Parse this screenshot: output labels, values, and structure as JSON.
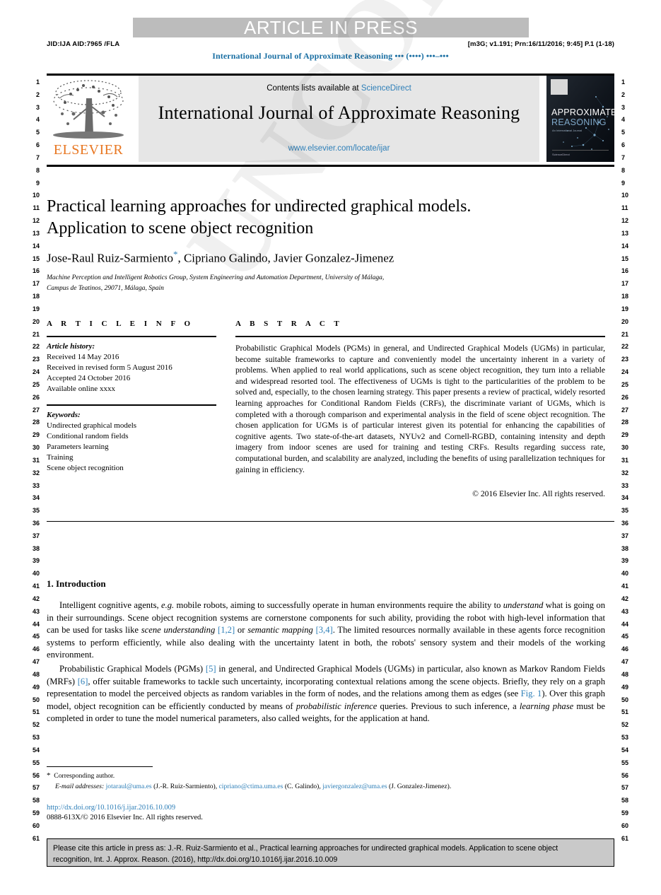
{
  "banner": {
    "article_in_press": "ARTICLE IN PRESS",
    "jid": "JID:IJA    AID:7965 /FLA",
    "build_stamp": "[m3G; v1.191; Prn:16/11/2016; 9:45] P.1 (1-18)",
    "running_head": "International Journal of Approximate Reasoning ••• (••••) •••–•••"
  },
  "masthead": {
    "contents_prefix": "Contents lists available at ",
    "sciencedirect": "ScienceDirect",
    "journal_title": "International Journal of Approximate Reasoning",
    "journal_url": "www.elsevier.com/locate/ijar",
    "publisher": "ELSEVIER",
    "cover_line1": "APPROXIMATE",
    "cover_line2": "REASONING",
    "cover_sub": "An International Journal",
    "cover_foot": "Available online at www.sciencedirect.com",
    "cover_foot2": "ScienceDirect"
  },
  "article": {
    "title_line1": "Practical learning approaches for undirected graphical models.",
    "title_line2": "Application to scene object recognition",
    "authors_part1": "Jose-Raul Ruiz-Sarmiento",
    "corresponding_marker": "*",
    "authors_part2": ", Cipriano Galindo, Javier Gonzalez-Jimenez",
    "affiliation_line1": "Machine Perception and Intelligent Robotics Group, System Engineering and Automation Department, University of Málaga,",
    "affiliation_line2": "Campus de Teatinos, 29071, Málaga, Spain"
  },
  "info": {
    "heading": "A R T I C L E   I N F O",
    "history_label": "Article history:",
    "history": [
      "Received 14 May 2016",
      "Received in revised form 5 August 2016",
      "Accepted 24 October 2016",
      "Available online xxxx"
    ],
    "keywords_label": "Keywords:",
    "keywords": [
      "Undirected graphical models",
      "Conditional random fields",
      "Parameters learning",
      "Training",
      "Scene object recognition"
    ]
  },
  "abstract": {
    "heading": "A B S T R A C T",
    "text": "Probabilistic Graphical Models (PGMs) in general, and Undirected Graphical Models (UGMs) in particular, become suitable frameworks to capture and conveniently model the uncertainty inherent in a variety of problems. When applied to real world applications, such as scene object recognition, they turn into a reliable and widespread resorted tool. The effectiveness of UGMs is tight to the particularities of the problem to be solved and, especially, to the chosen learning strategy. This paper presents a review of practical, widely resorted learning approaches for Conditional Random Fields (CRFs), the discriminate variant of UGMs, which is completed with a thorough comparison and experimental analysis in the field of scene object recognition. The chosen application for UGMs is of particular interest given its potential for enhancing the capabilities of cognitive agents. Two state-of-the-art datasets, NYUv2 and Cornell-RGBD, containing intensity and depth imagery from indoor scenes are used for training and testing CRFs. Results regarding success rate, computational burden, and scalability are analyzed, including the benefits of using parallelization techniques for gaining in efficiency.",
    "copyright": "© 2016 Elsevier Inc. All rights reserved."
  },
  "body": {
    "section_heading": "1. Introduction",
    "paragraph1": {
      "seg1": "Intelligent cognitive agents, ",
      "em1": "e.g.",
      "seg2": " mobile robots, aiming to successfully operate in human environments require the ability to ",
      "em2": "understand",
      "seg3": " what is going on in their surroundings. Scene object recognition systems are cornerstone components for such ability, providing the robot with high-level information that can be used for tasks like ",
      "em3": "scene understanding",
      "ref1": "[1,2]",
      "seg4": " or ",
      "em4": "semantic mapping",
      "ref2": "[3,4]",
      "seg5": ". The limited resources normally available in these agents force recognition systems to perform efficiently, while also dealing with the uncertainty latent in both, the robots' sensory system and their models of the working environment."
    },
    "paragraph2": {
      "seg1": "Probabilistic Graphical Models (PGMs) ",
      "ref1": "[5]",
      "seg2": " in general, and Undirected Graphical Models (UGMs) in particular, also known as Markov Random Fields (MRFs) ",
      "ref2": "[6]",
      "seg3": ", offer suitable frameworks to tackle such uncertainty, incorporating contextual relations among the scene objects. Briefly, they rely on a graph representation to model the perceived objects as random variables in the form of nodes, and the relations among them as edges (see ",
      "ref3": "Fig. 1",
      "seg4": "). Over this graph model, object recognition can be efficiently conducted by means of ",
      "em1": "probabilistic inference",
      "seg5": " queries. Previous to such inference, a ",
      "em2": "learning phase",
      "seg6": " must be completed in order to tune the model numerical parameters, also called weights, for the application at hand."
    }
  },
  "footnotes": {
    "corresponding": "Corresponding author.",
    "email_label": "E-mail addresses:",
    "emails": [
      {
        "address": "jotaraul@uma.es",
        "owner": "(J.-R. Ruiz-Sarmiento),"
      },
      {
        "address": "cipriano@ctima.uma.es",
        "owner": "(C. Galindo),"
      },
      {
        "address": "javiergonzalez@uma.es",
        "owner": "(J. Gonzalez-Jimenez)."
      }
    ],
    "doi": "http://dx.doi.org/10.1016/j.ijar.2016.10.009",
    "issn": "0888-613X/© 2016 Elsevier Inc. All rights reserved."
  },
  "cite_box": {
    "line1": "Please cite this article in press as: J.-R. Ruiz-Sarmiento et al., Practical learning approaches for undirected graphical models. Application to scene object",
    "line2": "recognition, Int. J. Approx. Reason. (2016), http://dx.doi.org/10.1016/j.ijar.2016.10.009"
  },
  "watermark": "UNCORRECTED PROOF",
  "line_numbers": {
    "first": 1,
    "last": 61
  },
  "colors": {
    "link": "#2e7fb8",
    "elsevier_orange": "#E87722",
    "banner_gray": "#bcbcbc",
    "masthead_gray": "#e6e6e6",
    "cite_gray": "#c9c9c9"
  }
}
